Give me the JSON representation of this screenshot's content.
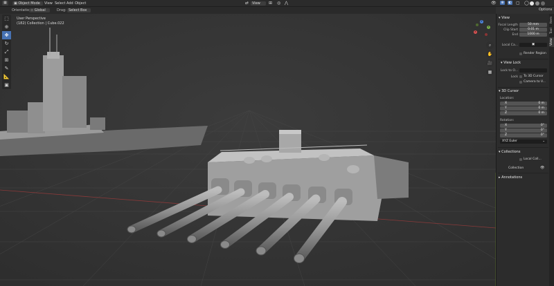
{
  "header": {
    "mode": "Object Mode",
    "menus": [
      "View",
      "Select",
      "Add",
      "Object"
    ],
    "view_menu": "View",
    "options": "Options"
  },
  "toolheader": {
    "orientation_label": "Orientation:",
    "orientation_value": "Global",
    "drag_label": "Drag:",
    "drag_value": "Select Box"
  },
  "viewport": {
    "title": "User Perspective",
    "subtitle": "(182) Collection | Cube.022"
  },
  "n_panel": {
    "tabs": [
      "Item",
      "Tool",
      "View"
    ],
    "view_section": "View",
    "focal_length_label": "Focal Length",
    "focal_length_value": "50 mm",
    "clip_start_label": "Clip Start",
    "clip_start_value": "0.01 m",
    "clip_end_label": "End",
    "clip_end_value": "1000 m",
    "local_camera_label": "Local Ca...",
    "render_region_label": "Render Region",
    "view_lock_section": "View Lock",
    "lock_to_object_label": "Lock to O...",
    "lock_label": "Lock",
    "to_3d_cursor_label": "To 3D Cursor",
    "camera_to_view_label": "Camera to V...",
    "cursor_section": "3D Cursor",
    "location_label": "Location:",
    "loc_x": "0 m",
    "loc_y": "0 m",
    "loc_z": "0 m",
    "rotation_label": "Rotation:",
    "rot_x": "0°",
    "rot_y": "0°",
    "rot_z": "0°",
    "rotation_mode": "XYZ Euler",
    "collections_section": "Collections",
    "local_collections_label": "Local Coll...",
    "collection_label": "Collection",
    "annotations_section": "Annotations",
    "axis_labels": {
      "x": "X",
      "y": "Y",
      "z": "Z"
    }
  }
}
